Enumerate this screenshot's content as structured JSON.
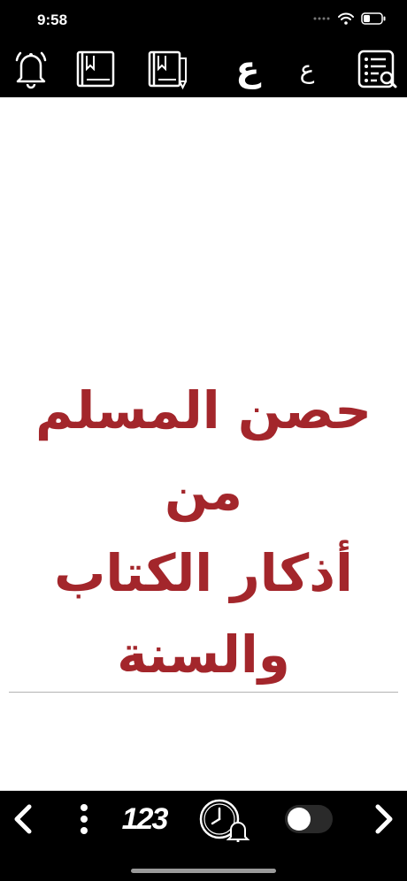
{
  "status_bar": {
    "time": "9:58"
  },
  "top_toolbar": {
    "arabic_letter_large": "ع",
    "arabic_letter_small": "ع"
  },
  "book": {
    "title_lines": [
      "حصن المسلم من",
      "أذكار الكتاب",
      "والسنة"
    ]
  },
  "bottom_toolbar": {
    "page_number_label": "123",
    "night_mode_on": false
  },
  "colors": {
    "bar_background": "#000000",
    "title_red": "#a3262b",
    "divider": "#b3b3b3"
  }
}
